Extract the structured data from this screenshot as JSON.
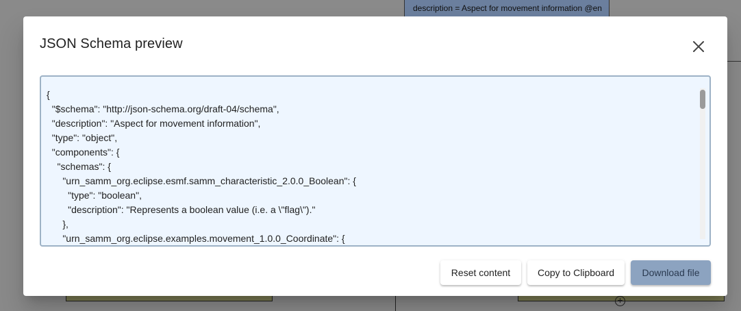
{
  "background": {
    "node_label": "description = Aspect for movement information @en"
  },
  "dialog": {
    "title": "JSON Schema preview",
    "close_icon": "close-icon",
    "editor_lines": [
      "{",
      "  \"$schema\": \"http://json-schema.org/draft-04/schema\",",
      "  \"description\": \"Aspect for movement information\",",
      "  \"type\": \"object\",",
      "  \"components\": {",
      "    \"schemas\": {",
      "      \"urn_samm_org.eclipse.esmf.samm_characteristic_2.0.0_Boolean\": {",
      "        \"type\": \"boolean\",",
      "        \"description\": \"Represents a boolean value (i.e. a \\\"flag\\\").\"",
      "      },",
      "      \"urn_samm_org.eclipse.examples.movement_1.0.0_Coordinate\": {"
    ],
    "buttons": {
      "reset": "Reset content",
      "copy": "Copy to Clipboard",
      "download": "Download file"
    }
  },
  "colors": {
    "overlay": "#8a8a8a",
    "editor_bg": "#eef6ff",
    "editor_border": "#9db2c6",
    "primary_button": "#8ca3c0"
  }
}
